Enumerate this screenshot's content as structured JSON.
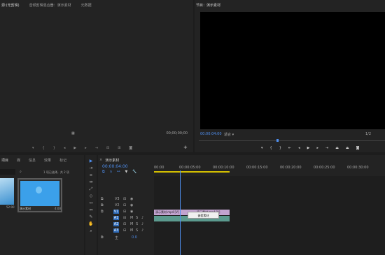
{
  "source_panel": {
    "tabs": [
      "源:(无剪辑)",
      "音频剪辑混合器：演示素材",
      "元数据"
    ],
    "timecode": "00;00;00;00"
  },
  "program_monitor": {
    "tab": "节目：演示素材",
    "timecode": "00:00:04:00",
    "fit": "适合",
    "quality": "1/2"
  },
  "project_panel": {
    "tabs": [
      "项目",
      "媒",
      "信息",
      "效果",
      "标记"
    ],
    "item_count": "1 项已选择，共 2 项",
    "items": [
      {
        "name": "",
        "duration": "52:00"
      },
      {
        "name": "演示素材",
        "duration": "4:00"
      }
    ]
  },
  "timeline": {
    "tab": "演示素材",
    "timecode": "00:00:04:00",
    "ruler": [
      "00:00",
      "00:00:05:00",
      "00:00:10:00",
      "00:00:15:00",
      "00:00:20:00",
      "00:00:25:00",
      "00:00:30:00"
    ],
    "tracks": [
      {
        "label": "V3",
        "type": "video"
      },
      {
        "label": "V2",
        "type": "video"
      },
      {
        "label": "V1",
        "type": "video"
      },
      {
        "label": "A1",
        "type": "audio"
      },
      {
        "label": "A2",
        "type": "audio"
      },
      {
        "label": "A3",
        "type": "audio"
      }
    ],
    "master_value": "0.0",
    "clip1": "演示素材.mp4 [V]",
    "clip2": "演示素材.mp4 [V]",
    "context_menu": "嵌套素材"
  }
}
